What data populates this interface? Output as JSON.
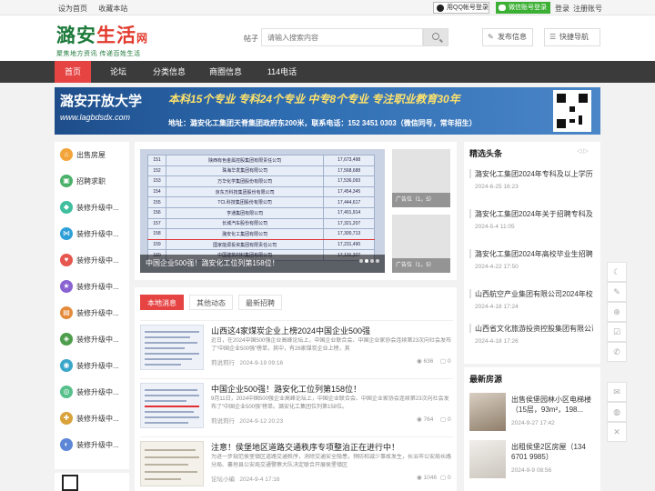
{
  "topbar": {
    "set_home": "设为首页",
    "bookmark": "收藏本站",
    "qq_login": "用QQ帐号登录",
    "wechat_login": "微信账号登录",
    "login": "登录",
    "register": "注册账号"
  },
  "header": {
    "logo_main_a": "潞安",
    "logo_main_b": "生活",
    "logo_main_net": "网",
    "logo_slogan": "聚焦地方资讯  传递百姓生活",
    "search_label": "帖子",
    "search_placeholder": "请输入搜索内容",
    "publish": "发布信息",
    "quick_nav": "快捷导航"
  },
  "nav": [
    {
      "label": "首页",
      "active": true
    },
    {
      "label": "论坛",
      "active": false
    },
    {
      "label": "分类信息",
      "active": false
    },
    {
      "label": "商圈信息",
      "active": false
    },
    {
      "label": "114电话",
      "active": false
    }
  ],
  "banner": {
    "line1": "潞安开放大学",
    "line2": "www.lagbdsdx.com",
    "line3": "本科15个专业  专科24个专业  中专8个专业  专注职业教育30年",
    "line4": "地址：潞安化工集团天脊集团政府东200米，联系电话：152 3451 0303（微信同号，常年招生）"
  },
  "left_sidebar": [
    {
      "label": "出售房屋",
      "color": "#f3a43a",
      "icon": "house-icon"
    },
    {
      "label": "招聘求职",
      "color": "#4ab06a",
      "icon": "briefcase-icon"
    },
    {
      "label": "装修升级中...",
      "color": "#3fbf9f",
      "icon": "apps-icon"
    },
    {
      "label": "装修升级中...",
      "color": "#2f9fd8",
      "icon": "share-icon"
    },
    {
      "label": "装修升级中...",
      "color": "#e6574f",
      "icon": "heart-icon"
    },
    {
      "label": "装修升级中...",
      "color": "#8a63d2",
      "icon": "star-icon"
    },
    {
      "label": "装修升级中...",
      "color": "#e58a3a",
      "icon": "cart-icon"
    },
    {
      "label": "装修升级中...",
      "color": "#4c9d4c",
      "icon": "tag-icon"
    },
    {
      "label": "装修升级中...",
      "color": "#3aa6c9",
      "icon": "car-icon"
    },
    {
      "label": "装修升级中...",
      "color": "#56c08a",
      "icon": "chat-icon"
    },
    {
      "label": "装修升级中...",
      "color": "#d9a23a",
      "icon": "gift-icon"
    },
    {
      "label": "装修升级中...",
      "color": "#5c86d6",
      "icon": "book-icon"
    }
  ],
  "slider": {
    "caption": "中国企业500强！潞安化工位列第158位！",
    "thumb1_caption": "广告位（1，5）",
    "thumb2_caption": "广告位（1，5）",
    "rows": [
      {
        "rank": "151",
        "name": "陕西有色金属控股集团有限责任公司",
        "value": "17,673,498"
      },
      {
        "rank": "152",
        "name": "珠海华发集团有限公司",
        "value": "17,568,688"
      },
      {
        "rank": "153",
        "name": "万华化学集团股份有限公司",
        "value": "17,536,093"
      },
      {
        "rank": "154",
        "name": "京东方科技集团股份有限公司",
        "value": "17,454,345"
      },
      {
        "rank": "155",
        "name": "TCL科技集团股份有限公司",
        "value": "17,444,617"
      },
      {
        "rank": "156",
        "name": "亨通集团有限公司",
        "value": "17,401,914"
      },
      {
        "rank": "157",
        "name": "长城汽车股份有限公司",
        "value": "17,321,207"
      },
      {
        "rank": "158",
        "name": "潞安化工集团有限公司",
        "value": "17,300,713"
      },
      {
        "rank": "159",
        "name": "国家能源投资集团有限责任公司",
        "value": "17,231,490"
      },
      {
        "rank": "160",
        "name": "中国建筑材料集团有限公司",
        "value": "17,131,327"
      }
    ]
  },
  "tabs": [
    {
      "label": "本地消息",
      "active": true
    },
    {
      "label": "其他动态",
      "active": false
    },
    {
      "label": "最新招聘",
      "active": false
    }
  ],
  "news": [
    {
      "title": "山西这4家煤炭企业上榜2024中国企业500强",
      "desc": "近日，在2024中国500强企业高峰论坛上，中国企业联合会、中国企业家协会连续第23次向社会发布了“中国企业500强”榜单，其中，有26家煤炭企业上榜，其",
      "author": "莉说莉行",
      "time": "2024-9-19 09:16",
      "views": "636",
      "comments": "0"
    },
    {
      "title": "中国企业500强！潞安化工位列第158位！",
      "desc": "9月11日，2024中国500强企业高峰论坛上，中国企业联合会、中国企业家协会连续第23次向社会发布了“中国企业500强”榜单。潞安化工集团位列第158位。",
      "author": "莉说莉行",
      "time": "2024-9-12 20:23",
      "views": "764",
      "comments": "0"
    },
    {
      "title": "注意！侯堡地区道路交通秩序专项整治正在进行中！",
      "desc": "为进一步规范侯堡镇区道路交通秩序，消除交通安全隐患，预防和减少事故发生，长治市公安局长路分局、襄垣县公安局交通警察大队决定联合开展侯堡镇区",
      "author": "论坛小编",
      "time": "2024-9-4 17:16",
      "views": "1046",
      "comments": "0"
    }
  ],
  "right_sidebar": {
    "featured_title": "精选头条",
    "arrows": "◁  ▷",
    "featured": [
      {
        "title": "潞安化工集团2024年专科及以上学历...",
        "date": "2024-6-25 16:23"
      },
      {
        "title": "潞安化工集团2024年关于招聘专科及以上学历...",
        "date": "2024-5-4 11:05"
      },
      {
        "title": "潞安化工集团2024年高校毕业生招聘...",
        "date": "2024-4-22 17:50"
      },
      {
        "title": "山西航空产业集团有限公司2024年校...",
        "date": "2024-4-18 17:24"
      },
      {
        "title": "山西省文化旅游投资控股集团有限公司...",
        "date": "2024-4-18 17:26"
      }
    ],
    "houses_title": "最新房源",
    "houses": [
      {
        "title": "出售侯堡园林小区电梯楼（15层，93m²，198...",
        "date": "2024-9-27 17:42"
      },
      {
        "title": "出租侯堡2区房屋（134 6701 9985）",
        "date": "2024-9-9 08:56"
      }
    ]
  },
  "tools": [
    "moon-icon",
    "edit-icon",
    "plus-icon",
    "check-icon",
    "phone-icon",
    "chat-icon",
    "wechat-icon",
    "close-icon"
  ]
}
